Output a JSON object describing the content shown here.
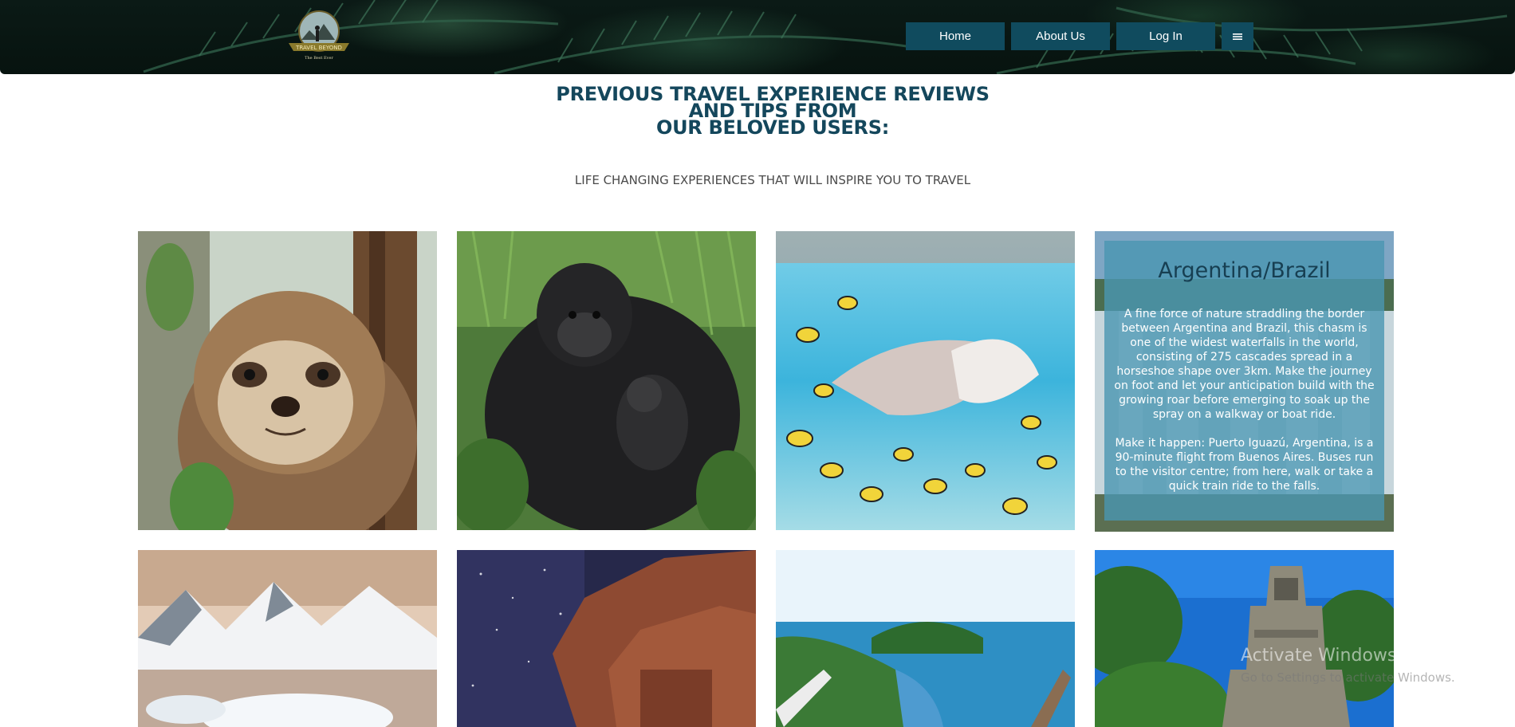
{
  "header": {
    "logo": {
      "text": "TRAVEL BEYOND",
      "tagline": "The Best Ever"
    },
    "nav": {
      "home": "Home",
      "about": "About Us",
      "login": "Log In",
      "menu_icon": "hamburger-icon"
    }
  },
  "main": {
    "title_lines": [
      "PREVIOUS TRAVEL EXPERIENCE REVIEWS",
      "AND TIPS FROM",
      "OUR BELOVED USERS:"
    ],
    "subtitle": "LIFE CHANGING EXPERIENCES THAT WILL INSPIRE YOU TO TRAVEL"
  },
  "gallery": {
    "tiles": [
      {
        "image": "sloth-photo"
      },
      {
        "image": "gorilla-photo"
      },
      {
        "image": "stingray-fish-photo"
      },
      {
        "image": "waterfall-photo",
        "title": "Argentina/Brazil",
        "text1": "A fine force of nature straddling the border between Argentina and Brazil, this chasm is one of the widest waterfalls in the world, consisting of 275 cascades spread in a horseshoe shape over 3km. Make the journey on foot and let your anticipation build with the growing roar before emerging to soak up the spray on a walkway or boat ride.",
        "text2": "Make it happen: Puerto Iguazú, Argentina, is a 90-minute flight from Buenos Aires. Buses run to the visitor centre; from here, walk or take a quick train ride to the falls."
      },
      {
        "image": "antarctica-photo"
      },
      {
        "image": "petra-photo"
      },
      {
        "image": "coastline-photo"
      },
      {
        "image": "tikal-temple-photo"
      }
    ]
  },
  "watermark": {
    "title": "Activate Windows",
    "sub": "Go to Settings to activate Windows."
  },
  "colors": {
    "nav_bg": "#104b5e",
    "title": "#14475c",
    "overlay": "#4a96b2"
  }
}
